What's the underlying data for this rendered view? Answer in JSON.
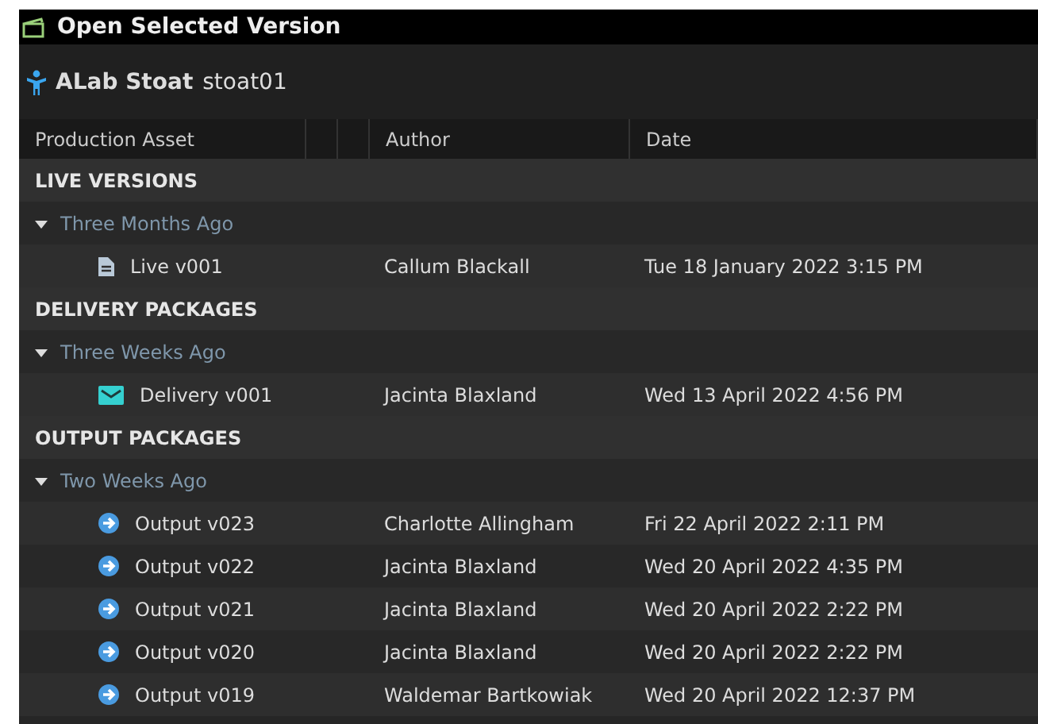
{
  "window": {
    "title": "Open Selected Version"
  },
  "asset": {
    "name": "ALab Stoat",
    "code": "stoat01"
  },
  "table": {
    "columns": [
      "Production Asset",
      "",
      "",
      "Author",
      "Date"
    ],
    "sections": [
      {
        "title": "LIVE VERSIONS",
        "groups": [
          {
            "label": "Three Months Ago",
            "expanded": true,
            "rows": [
              {
                "kind": "document",
                "name": "Live v001",
                "author": "Callum Blackall",
                "date": "Tue 18 January 2022 3:15 PM"
              }
            ]
          }
        ]
      },
      {
        "title": "DELIVERY PACKAGES",
        "groups": [
          {
            "label": "Three Weeks Ago",
            "expanded": true,
            "rows": [
              {
                "kind": "envelope",
                "name": "Delivery v001",
                "author": "Jacinta Blaxland",
                "date": "Wed 13 April 2022 4:56 PM"
              }
            ]
          }
        ]
      },
      {
        "title": "OUTPUT PACKAGES",
        "groups": [
          {
            "label": "Two Weeks Ago",
            "expanded": true,
            "rows": [
              {
                "kind": "arrow",
                "name": "Output v023",
                "author": "Charlotte Allingham",
                "date": "Fri 22 April 2022 2:11 PM"
              },
              {
                "kind": "arrow",
                "name": "Output v022",
                "author": "Jacinta Blaxland",
                "date": "Wed 20 April 2022 4:35 PM"
              },
              {
                "kind": "arrow",
                "name": "Output v021",
                "author": "Jacinta Blaxland",
                "date": "Wed 20 April 2022 2:22 PM"
              },
              {
                "kind": "arrow",
                "name": "Output v020",
                "author": "Jacinta Blaxland",
                "date": "Wed 20 April 2022 2:22 PM"
              },
              {
                "kind": "arrow",
                "name": "Output v019",
                "author": "Waldemar Bartkowiak",
                "date": "Wed 20 April 2022 12:37 PM"
              }
            ]
          }
        ]
      }
    ]
  }
}
